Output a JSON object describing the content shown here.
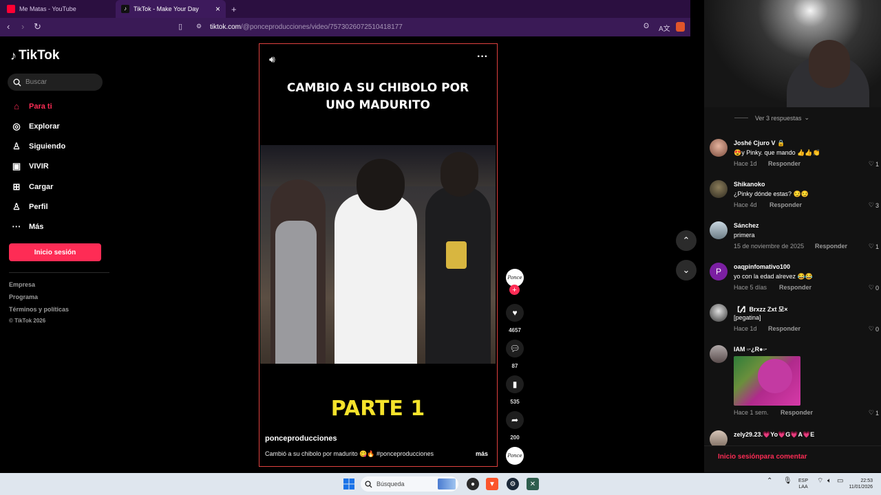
{
  "browser": {
    "tabs": [
      {
        "label": "Me Matas - YouTube",
        "icon": "youtube-icon",
        "active": false
      },
      {
        "label": "TikTok - Make Your Day",
        "icon": "tiktok-icon",
        "active": true
      }
    ],
    "new_tab": "+",
    "close_tab": "×",
    "url_domain": "tiktok.com",
    "url_path": "/@ponceproducciones/video/7573026072510418177"
  },
  "sidebar": {
    "logo": "TikTok",
    "search_placeholder": "Buscar",
    "nav": [
      {
        "label": "Para ti",
        "icon": "home-icon",
        "active": true
      },
      {
        "label": "Explorar",
        "icon": "compass-icon"
      },
      {
        "label": "Siguiendo",
        "icon": "user-follow-icon"
      },
      {
        "label": "VIVIR",
        "icon": "live-icon"
      },
      {
        "label": "Cargar",
        "icon": "upload-icon"
      },
      {
        "label": "Perfil",
        "icon": "profile-icon"
      },
      {
        "label": "Más",
        "icon": "more-icon"
      }
    ],
    "login_button": "Inicio sesión",
    "footer": [
      "Empresa",
      "Programa",
      "Términos y políticas",
      "© TikTok 2026"
    ]
  },
  "video": {
    "title_line1": "CAMBIO A SU CHIBOLO POR",
    "title_line2": "UNO MADURITO",
    "overlay": "PARTE 1",
    "author": "ponceproducciones",
    "caption": "Cambió a su chibolo por madurito 😋🔥 #ponceproducciones",
    "more": "más",
    "sound_icon": "volume-icon",
    "menu_icon": "more-horizontal-icon"
  },
  "actions": {
    "avatar_text": "Ponce",
    "likes": "4657",
    "comments": "87",
    "saves": "535",
    "shares": "200"
  },
  "comments_panel": {
    "view_replies": "Ver 3 respuestas",
    "items": [
      {
        "user": "Joshé Cjuro V 🔒",
        "text": "😍y Pinky. que mando 👍👍👏",
        "time": "Hace 1d",
        "reply": "Responder",
        "likes": "1"
      },
      {
        "user": "Shikanoko",
        "text": "¿Pinky dónde estas? 😏😏",
        "time": "Hace 4d",
        "reply": "Responder",
        "likes": "3"
      },
      {
        "user": "Sánchez",
        "text": "primera",
        "time": "15 de noviembre de 2025",
        "reply": "Responder",
        "likes": "1"
      },
      {
        "user": "oaqpinfomativo100",
        "text": "yo con la edad alrevez 😂😂",
        "time": "Hace 5 días",
        "reply": "Responder",
        "likes": "0",
        "avatar_letter": "P"
      },
      {
        "user": "【𝓯】Brxzz Zxt 모×",
        "text": "[pegatina]",
        "time": "Hace 1d",
        "reply": "Responder",
        "likes": "0"
      },
      {
        "user": "IAM ▫·¿R●▫·",
        "text": "",
        "time": "Hace 1 sem.",
        "reply": "Responder",
        "likes": "1"
      },
      {
        "user": "zely29.23.💗Yo💗G💗A💗E",
        "text": "",
        "time": "",
        "reply": "",
        "likes": ""
      }
    ],
    "login_prompt": "Inicio sesiónpara comentar"
  },
  "taskbar": {
    "search_placeholder": "Búsqueda",
    "lang_line1": "ESP",
    "lang_line2": "LAA",
    "time": "22:53",
    "date": "11/01/2026"
  },
  "colors": {
    "brand": "#fe2c55",
    "video_border": "#e0413f",
    "overlay_yellow": "#f4e22b",
    "browser_purple": "#2b0f40"
  }
}
